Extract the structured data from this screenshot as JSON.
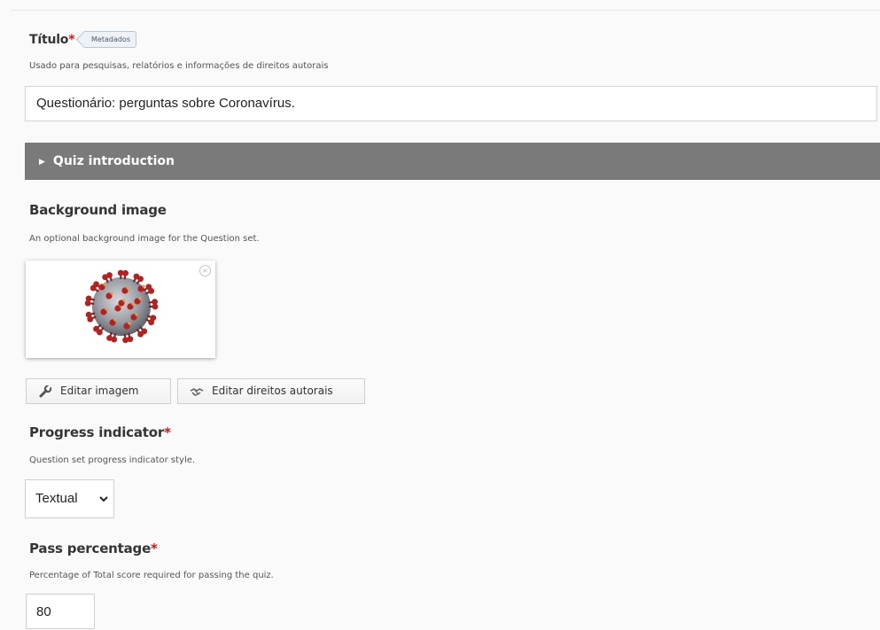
{
  "title_field": {
    "label": "Título",
    "required_mark": "*",
    "badge": "Metadados",
    "description": "Usado para pesquisas, relatórios e informações de direitos autorais",
    "value": "Questionário: perguntas sobre Coronavírus."
  },
  "quiz_intro": {
    "label": "Quiz introduction",
    "state": "collapsed"
  },
  "background_image": {
    "label": "Background image",
    "description": "An optional background image for the Question set.",
    "edit_image_label": "Editar imagem",
    "edit_copyright_label": "Editar direitos autorais",
    "remove_symbol": "×"
  },
  "progress_indicator": {
    "label": "Progress indicator",
    "required_mark": "*",
    "description": "Question set progress indicator style.",
    "selected": "Textual"
  },
  "pass_percentage": {
    "label": "Pass percentage",
    "required_mark": "*",
    "description": "Percentage of Total score required for passing the quiz.",
    "value": "80"
  },
  "colors": {
    "accent_header": "#7a7a7a",
    "required": "#d9121b",
    "virus_red": "#b8201f",
    "virus_grey": "#9aa0a6"
  }
}
